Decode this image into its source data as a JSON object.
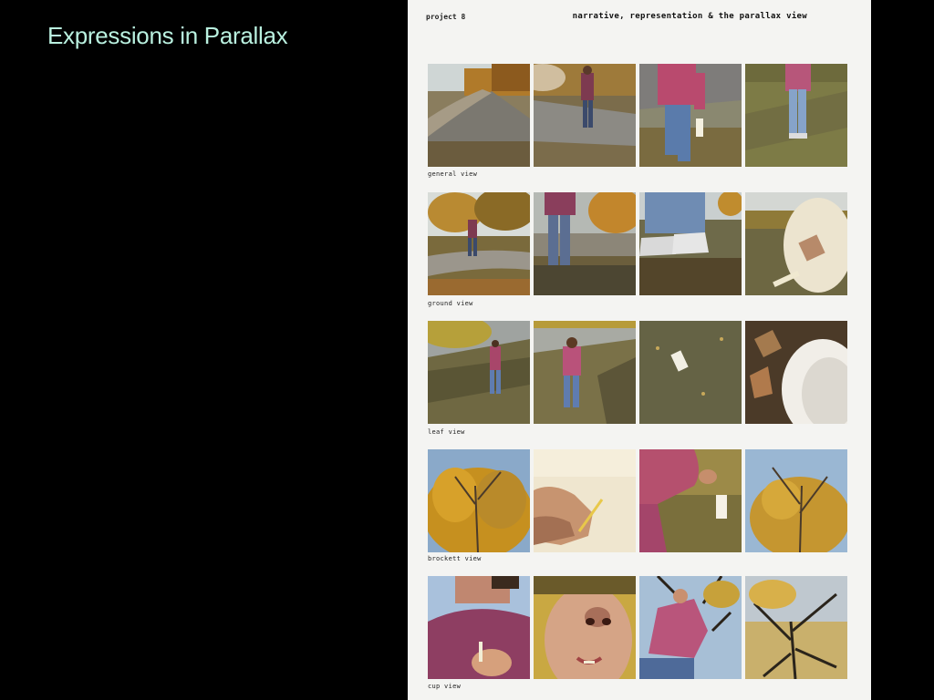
{
  "slide": {
    "title": "Expressions in Parallax"
  },
  "page": {
    "project_label": "project 8",
    "project_title": "narrative, representation & the parallax view"
  },
  "rows": [
    {
      "caption": "general view",
      "photos": [
        "path-and-trees-photo",
        "walking-path-photo",
        "girl-with-cup-photo",
        "girl-on-grass-photo"
      ]
    },
    {
      "caption": "ground view",
      "photos": [
        "girl-under-trees-photo",
        "legs-on-path-photo",
        "sneakers-close-photo",
        "cup-on-ground-photo"
      ]
    },
    {
      "caption": "leaf view",
      "photos": [
        "girl-walking-leaves-photo",
        "girl-walking-grass-photo",
        "cup-in-grass-photo",
        "cup-and-leaves-photo"
      ]
    },
    {
      "caption": "brockett view",
      "photos": [
        "autumn-tree-photo",
        "hand-in-cup-photo",
        "arm-reaching-photo",
        "tree-sky-photo"
      ]
    },
    {
      "caption": "cup view",
      "photos": [
        "girl-from-below-photo",
        "face-close-up-photo",
        "girl-leaning-photo",
        "bare-tree-sky-photo"
      ]
    }
  ]
}
